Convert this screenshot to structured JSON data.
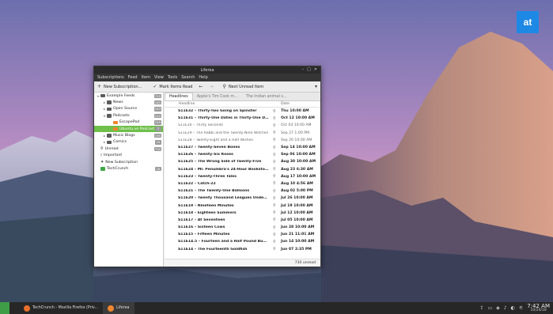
{
  "logo": {
    "text": "at"
  },
  "window": {
    "title": "Liferea"
  },
  "menu": [
    "Subscriptions",
    "Feed",
    "Item",
    "View",
    "Tools",
    "Search",
    "Help"
  ],
  "toolbar": {
    "new_subscription": "New Subscription...",
    "mark_read": "Mark Items Read",
    "next_unread": "Next Unread Item"
  },
  "feeds": [
    {
      "label": "Example Feeds",
      "count": "710",
      "level": 0,
      "type": "folder",
      "arrow": "▾"
    },
    {
      "label": "News",
      "count": "165",
      "level": 1,
      "type": "folder",
      "arrow": "▸"
    },
    {
      "label": "Open Source",
      "count": "183",
      "level": 1,
      "type": "folder",
      "arrow": "▸"
    },
    {
      "label": "Podcasts",
      "count": "142",
      "level": 1,
      "type": "folder",
      "arrow": "▾"
    },
    {
      "label": "EscapePod",
      "count": "135",
      "level": 2,
      "type": "feed",
      "arrow": ""
    },
    {
      "label": "Ubuntu.ve Podcast",
      "count": "7",
      "level": 2,
      "type": "feed",
      "arrow": "",
      "selected": true
    },
    {
      "label": "Music Blogs",
      "count": "195",
      "level": 1,
      "type": "folder",
      "arrow": "▸"
    },
    {
      "label": "Comics",
      "count": "25",
      "level": 1,
      "type": "folder",
      "arrow": "▸"
    },
    {
      "label": "Unread",
      "count": "730",
      "level": 0,
      "type": "search",
      "arrow": ""
    },
    {
      "label": "Important",
      "count": "",
      "level": 0,
      "type": "flag",
      "arrow": ""
    },
    {
      "label": "New Subscription",
      "count": "",
      "level": 0,
      "type": "sub",
      "arrow": ""
    },
    {
      "label": "TechCrunch",
      "count": "18",
      "level": 0,
      "type": "feedgreen",
      "arrow": ""
    }
  ],
  "tabs": [
    {
      "label": "Headlines",
      "active": true
    },
    {
      "label": "Apple's Tim Cook m...",
      "active": false
    },
    {
      "label": "The Indian animal s...",
      "active": false
    }
  ],
  "columns": {
    "headline": "Headline",
    "date": "Date"
  },
  "headlines": [
    {
      "title": "S11E32 – Thirty-Two Going on Spinster",
      "date": "Thu 10:00 AM",
      "unread": true
    },
    {
      "title": "S11E31 – Thirty-One Dates in Thirty-One Days",
      "date": "Oct 12 10:00 AM",
      "unread": true
    },
    {
      "title": "S11E30 – Thirty Seconds",
      "date": "Oct 04 10:00 AM",
      "unread": false
    },
    {
      "title": "S11E29 – The Rabbi and the Twenty-Nine Witches",
      "date": "Sep 27 1:00 PM",
      "unread": false
    },
    {
      "title": "S11E28 – Twenty-Eight and a Half Wishes",
      "date": "Sep 20 10:00 AM",
      "unread": false
    },
    {
      "title": "S11E27 – Twenty-Seven Bones",
      "date": "Sep 14 10:00 AM",
      "unread": true
    },
    {
      "title": "S11E26 – Twenty-Six Roses",
      "date": "Sep 06 10:00 AM",
      "unread": true
    },
    {
      "title": "S11E25 – The Wrong Side of Twenty-Five",
      "date": "Aug 30 10:00 AM",
      "unread": true
    },
    {
      "title": "S11E24 – Mr. Penumbra's 24-Hour Bookstore",
      "date": "Aug 23 6:30 AM",
      "unread": true
    },
    {
      "title": "S11E23 – Twenty-Three Tales",
      "date": "Aug 17 10:00 AM",
      "unread": true
    },
    {
      "title": "S11E22 – Catch-22",
      "date": "Aug 10 4:56 AM",
      "unread": true
    },
    {
      "title": "S11E21 – The Twenty-One Balloons",
      "date": "Aug 02 5:00 PM",
      "unread": true
    },
    {
      "title": "S11E20 – Twenty Thousand Leagues Under t...",
      "date": "Jul 26 10:00 AM",
      "unread": true
    },
    {
      "title": "S11E19 – Nineteen Minutes",
      "date": "Jul 19 10:00 AM",
      "unread": true
    },
    {
      "title": "S11E18 – Eighteen Summers",
      "date": "Jul 12 10:00 AM",
      "unread": true
    },
    {
      "title": "S11E17 – At Seventeen",
      "date": "Jul 05 10:00 AM",
      "unread": true
    },
    {
      "title": "S11E16 – Sixteen Cows",
      "date": "Jun 28 10:00 AM",
      "unread": true
    },
    {
      "title": "S11E15 – Fifteen Minutes",
      "date": "Jun 21 11:01 AM",
      "unread": true
    },
    {
      "title": "S11E14.5 – Fourteen and a Half Pound Budgie",
      "date": "Jun 14 10:00 AM",
      "unread": true
    },
    {
      "title": "S11E14 – The Fourteenth Goldfish",
      "date": "Jun 07 2:35 PM",
      "unread": true
    }
  ],
  "status": "730 unread",
  "taskbar": {
    "tasks": [
      {
        "label": "TechCrunch - Mozilla Firefox (Priv...",
        "active": false
      },
      {
        "label": "Liferea",
        "active": true
      }
    ],
    "time": "7:42 AM",
    "date": "10/24/18"
  },
  "colors": {
    "accent": "#6fbf4b",
    "logo": "#1e88e5",
    "taskbar": "#272727"
  }
}
